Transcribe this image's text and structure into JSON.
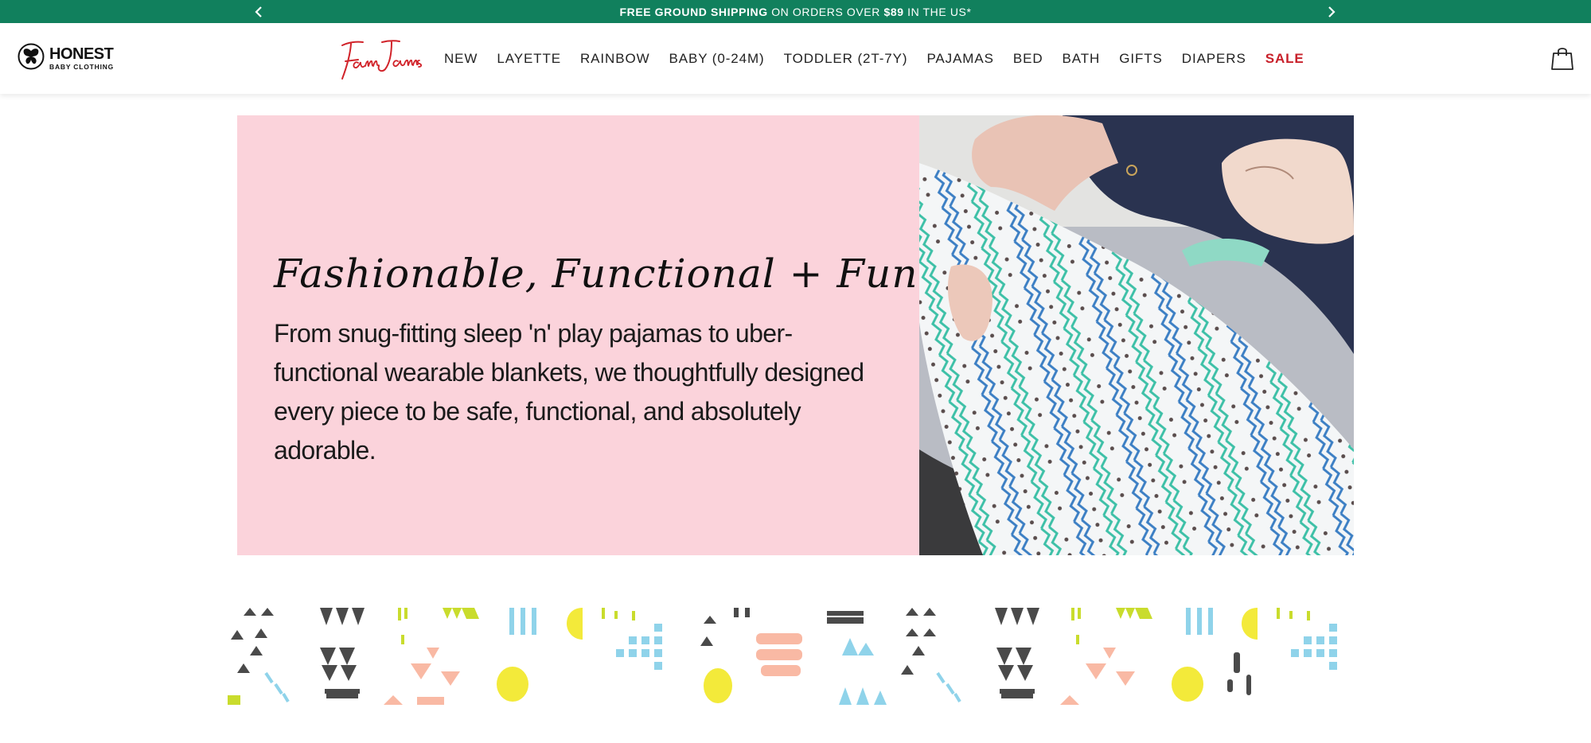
{
  "promo": {
    "bold1": "FREE GROUND SHIPPING",
    "text1": " ON ORDERS OVER ",
    "bold2": "$89",
    "text2": " IN THE US*",
    "prev_icon": "chevron-left-icon",
    "next_icon": "chevron-right-icon"
  },
  "brand": {
    "logo_main": "HONEST",
    "logo_sub": "BABY CLOTHING",
    "logo_icon": "butterfly-icon",
    "sub_brand": "FamJams"
  },
  "nav": {
    "items": [
      {
        "label": "NEW"
      },
      {
        "label": "LAYETTE"
      },
      {
        "label": "RAINBOW"
      },
      {
        "label": "BABY (0-24M)"
      },
      {
        "label": "TODDLER (2T-7Y)"
      },
      {
        "label": "PAJAMAS"
      },
      {
        "label": "BED"
      },
      {
        "label": "BATH"
      },
      {
        "label": "GIFTS"
      },
      {
        "label": "DIAPERS"
      },
      {
        "label": "SALE"
      }
    ],
    "cart_icon": "shopping-bag-icon"
  },
  "hero": {
    "tagline": "Fashionable, Functional + Fun",
    "description": "From snug-fitting sleep 'n' play pajamas to uber-functional wearable blankets, we thoughtfully designed every piece to be safe, functional, and absolutely adorable."
  },
  "colors": {
    "promo_bg": "#11805d",
    "hero_bg": "#fbd3db",
    "sale": "#c8202a",
    "pattern_dark": "#4a4a4a",
    "pattern_blue": "#8fd3ea",
    "pattern_lime": "#c9dc2d",
    "pattern_peach": "#f9b9a4",
    "pattern_yellow": "#f3ea3a"
  }
}
